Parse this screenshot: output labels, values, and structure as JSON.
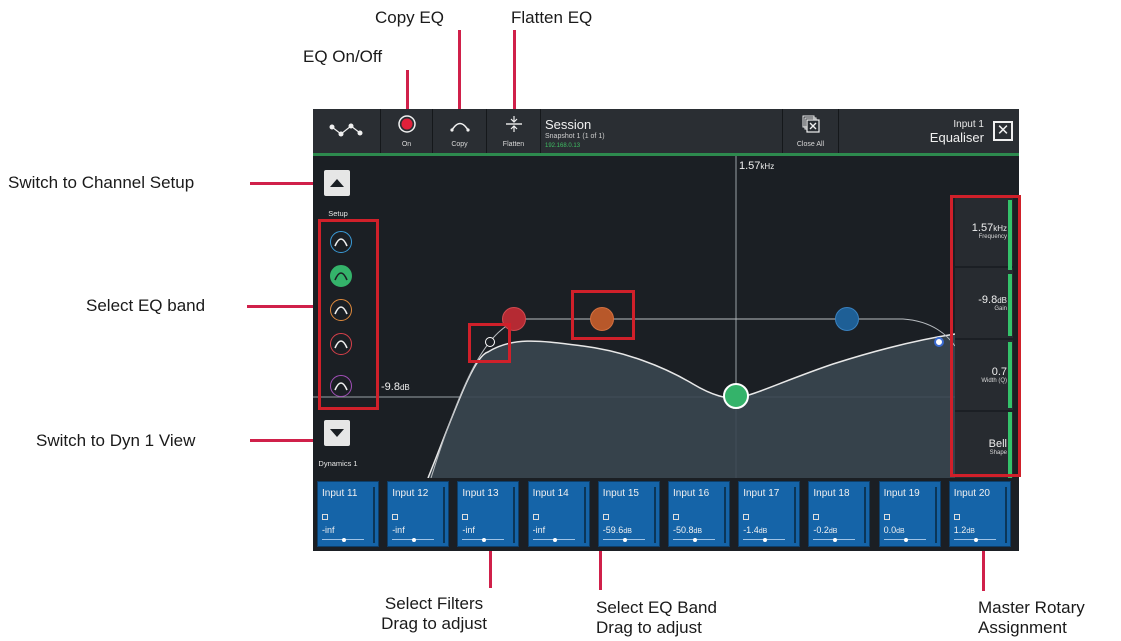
{
  "annotations": {
    "copy_eq": "Copy EQ",
    "flatten_eq": "Flatten EQ",
    "eq_on_off": "EQ On/Off",
    "switch_channel_setup": "Switch to Channel Setup",
    "select_eq_band": "Select EQ band",
    "switch_dyn_view": "Switch to Dyn 1 View",
    "select_filters_l1": "Select Filters",
    "select_filters_l2": "Drag to adjust",
    "select_band_l1": "Select EQ Band",
    "select_band_l2": "Drag to adjust",
    "master_rotary_l1": "Master Rotary",
    "master_rotary_l2": "Assignment"
  },
  "toolbar": {
    "on_label": "On",
    "copy_label": "Copy",
    "flatten_label": "Flatten",
    "close_all_label": "Close All",
    "icons": [
      "network-icon",
      "record-icon",
      "copy-curve-icon",
      "flatten-icon",
      "close-all-icon",
      "close-icon"
    ]
  },
  "session": {
    "title": "Session",
    "snapshot": "Snapshot 1 (1 of 1)",
    "ip": "192.168.0.13"
  },
  "header": {
    "channel": "Input 1",
    "view": "Equaliser"
  },
  "left": {
    "setup_label": "Setup",
    "dynamics_label": "Dynamics 1"
  },
  "bands": [
    {
      "name": "band-1",
      "color": "#3a9bd8"
    },
    {
      "name": "band-2",
      "color": "#34b36a"
    },
    {
      "name": "band-3",
      "color": "#e08a3c"
    },
    {
      "name": "band-4",
      "color": "#d8404a"
    },
    {
      "name": "band-5",
      "color": "#a24fb8"
    }
  ],
  "graph": {
    "freq_value": "1.57",
    "freq_unit": "kHz",
    "gain_value": "-9.8",
    "gain_unit": "dB"
  },
  "rotary": {
    "frequency_value": "1.57",
    "frequency_unit": "kHz",
    "frequency_name": "Frequency",
    "gain_value": "-9.8",
    "gain_unit": "dB",
    "gain_name": "Gain",
    "width_value": "0.7",
    "width_name": "Width (Q)",
    "shape_value": "Bell",
    "shape_name": "Shape"
  },
  "strips": [
    {
      "name": "Input 11",
      "value": "-inf",
      "unit": ""
    },
    {
      "name": "Input 12",
      "value": "-inf",
      "unit": ""
    },
    {
      "name": "Input 13",
      "value": "-inf",
      "unit": ""
    },
    {
      "name": "Input 14",
      "value": "-inf",
      "unit": ""
    },
    {
      "name": "Input 15",
      "value": "-59.6",
      "unit": "dB"
    },
    {
      "name": "Input 16",
      "value": "-50.8",
      "unit": "dB"
    },
    {
      "name": "Input 17",
      "value": "-1.4",
      "unit": "dB"
    },
    {
      "name": "Input 18",
      "value": "-0.2",
      "unit": "dB"
    },
    {
      "name": "Input 19",
      "value": "0.0",
      "unit": "dB"
    },
    {
      "name": "Input 20",
      "value": "1.2",
      "unit": "dB"
    }
  ],
  "colors": {
    "accent_green": "#34c26a",
    "annotation_red": "#d0204a",
    "strip_blue": "#1564a8"
  }
}
